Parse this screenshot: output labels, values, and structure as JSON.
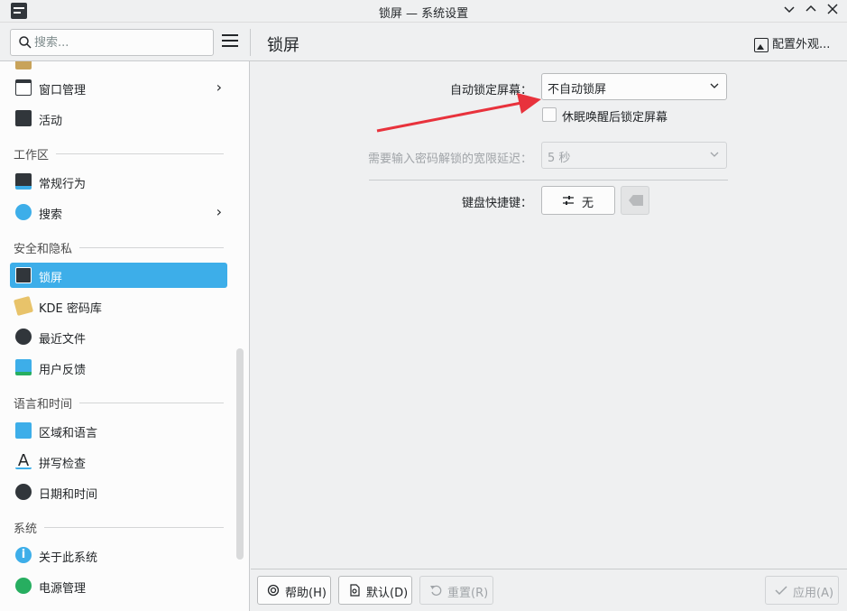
{
  "window": {
    "title": "锁屏 — 系统设置",
    "minimize_icon": "chevron-down-icon",
    "maximize_icon": "chevron-up-icon",
    "close_icon": "close-icon"
  },
  "header": {
    "search_placeholder": "搜索...",
    "page_title": "锁屏",
    "configure_appearance": "配置外观..."
  },
  "sidebar": {
    "items": [
      {
        "label": "窗口管理",
        "has_children": true,
        "icon": "window-management-icon"
      },
      {
        "label": "活动",
        "has_children": false,
        "icon": "activities-icon"
      },
      {
        "section": "工作区"
      },
      {
        "label": "常规行为",
        "has_children": false,
        "icon": "general-behavior-icon"
      },
      {
        "label": "搜索",
        "has_children": true,
        "icon": "search-settings-icon"
      },
      {
        "section": "安全和隐私"
      },
      {
        "label": "锁屏",
        "has_children": false,
        "active": true,
        "icon": "lock-screen-icon"
      },
      {
        "label": "KDE 密码库",
        "has_children": false,
        "icon": "kde-wallet-icon"
      },
      {
        "label": "最近文件",
        "has_children": false,
        "icon": "recent-files-icon"
      },
      {
        "label": "用户反馈",
        "has_children": false,
        "icon": "user-feedback-icon"
      },
      {
        "section": "语言和时间"
      },
      {
        "label": "区域和语言",
        "has_children": false,
        "icon": "region-language-icon"
      },
      {
        "label": "拼写检查",
        "has_children": false,
        "icon": "spell-check-icon"
      },
      {
        "label": "日期和时间",
        "has_children": false,
        "icon": "date-time-icon"
      },
      {
        "section": "系统"
      },
      {
        "label": "关于此系统",
        "has_children": false,
        "icon": "about-system-icon"
      },
      {
        "label": "电源管理",
        "has_children": false,
        "icon": "power-management-icon"
      }
    ]
  },
  "main": {
    "auto_lock_label": "自动锁定屏幕：",
    "auto_lock_value": "不自动锁屏",
    "resume_lock_label": "休眠唤醒后锁定屏幕",
    "resume_lock_checked": false,
    "grace_label": "需要输入密码解锁的宽限延迟：",
    "grace_value": "5 秒",
    "shortcut_label": "键盘快捷键：",
    "shortcut_value": "无"
  },
  "footer": {
    "help": "帮助(H)",
    "defaults": "默认(D)",
    "reset": "重置(R)",
    "apply": "应用(A)"
  },
  "colors": {
    "accent": "#3daee9",
    "annotation_arrow": "#e8323c"
  }
}
